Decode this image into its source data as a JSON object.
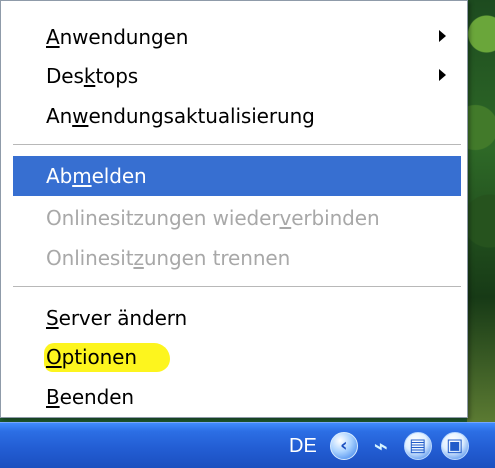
{
  "menu": {
    "items": [
      {
        "before": "",
        "underline": "A",
        "after": "nwendungen",
        "state": "normal",
        "submenu": true
      },
      {
        "before": "Des",
        "underline": "k",
        "after": "tops",
        "state": "normal",
        "submenu": true
      },
      {
        "before": "An",
        "underline": "w",
        "after": "endungsaktualisierung",
        "state": "normal",
        "submenu": false
      },
      {
        "before": "Ab",
        "underline": "m",
        "after": "elden",
        "state": "selected",
        "submenu": false
      },
      {
        "before": "Onlinesitzungen wieder",
        "underline": "v",
        "after": "erbinden",
        "state": "disabled",
        "submenu": false
      },
      {
        "before": "Onlinesit",
        "underline": "z",
        "after": "ungen trennen",
        "state": "disabled",
        "submenu": false
      },
      {
        "before": "",
        "underline": "S",
        "after": "erver ändern",
        "state": "normal",
        "submenu": false
      },
      {
        "before": "",
        "underline": "O",
        "after": "ptionen",
        "state": "highlighted",
        "submenu": false
      },
      {
        "before": "",
        "underline": "B",
        "after": "eenden",
        "state": "normal",
        "submenu": false
      }
    ]
  },
  "taskbar": {
    "language": "DE",
    "icons": [
      "chevron-left-icon",
      "network-icon",
      "printer-icon",
      "window-icon"
    ]
  },
  "colors": {
    "menu_background": "#ffffff",
    "selection": "#376fd1",
    "highlight": "#fdf51e",
    "disabled_text": "#a8a8a8",
    "taskbar": "#235ed4"
  }
}
